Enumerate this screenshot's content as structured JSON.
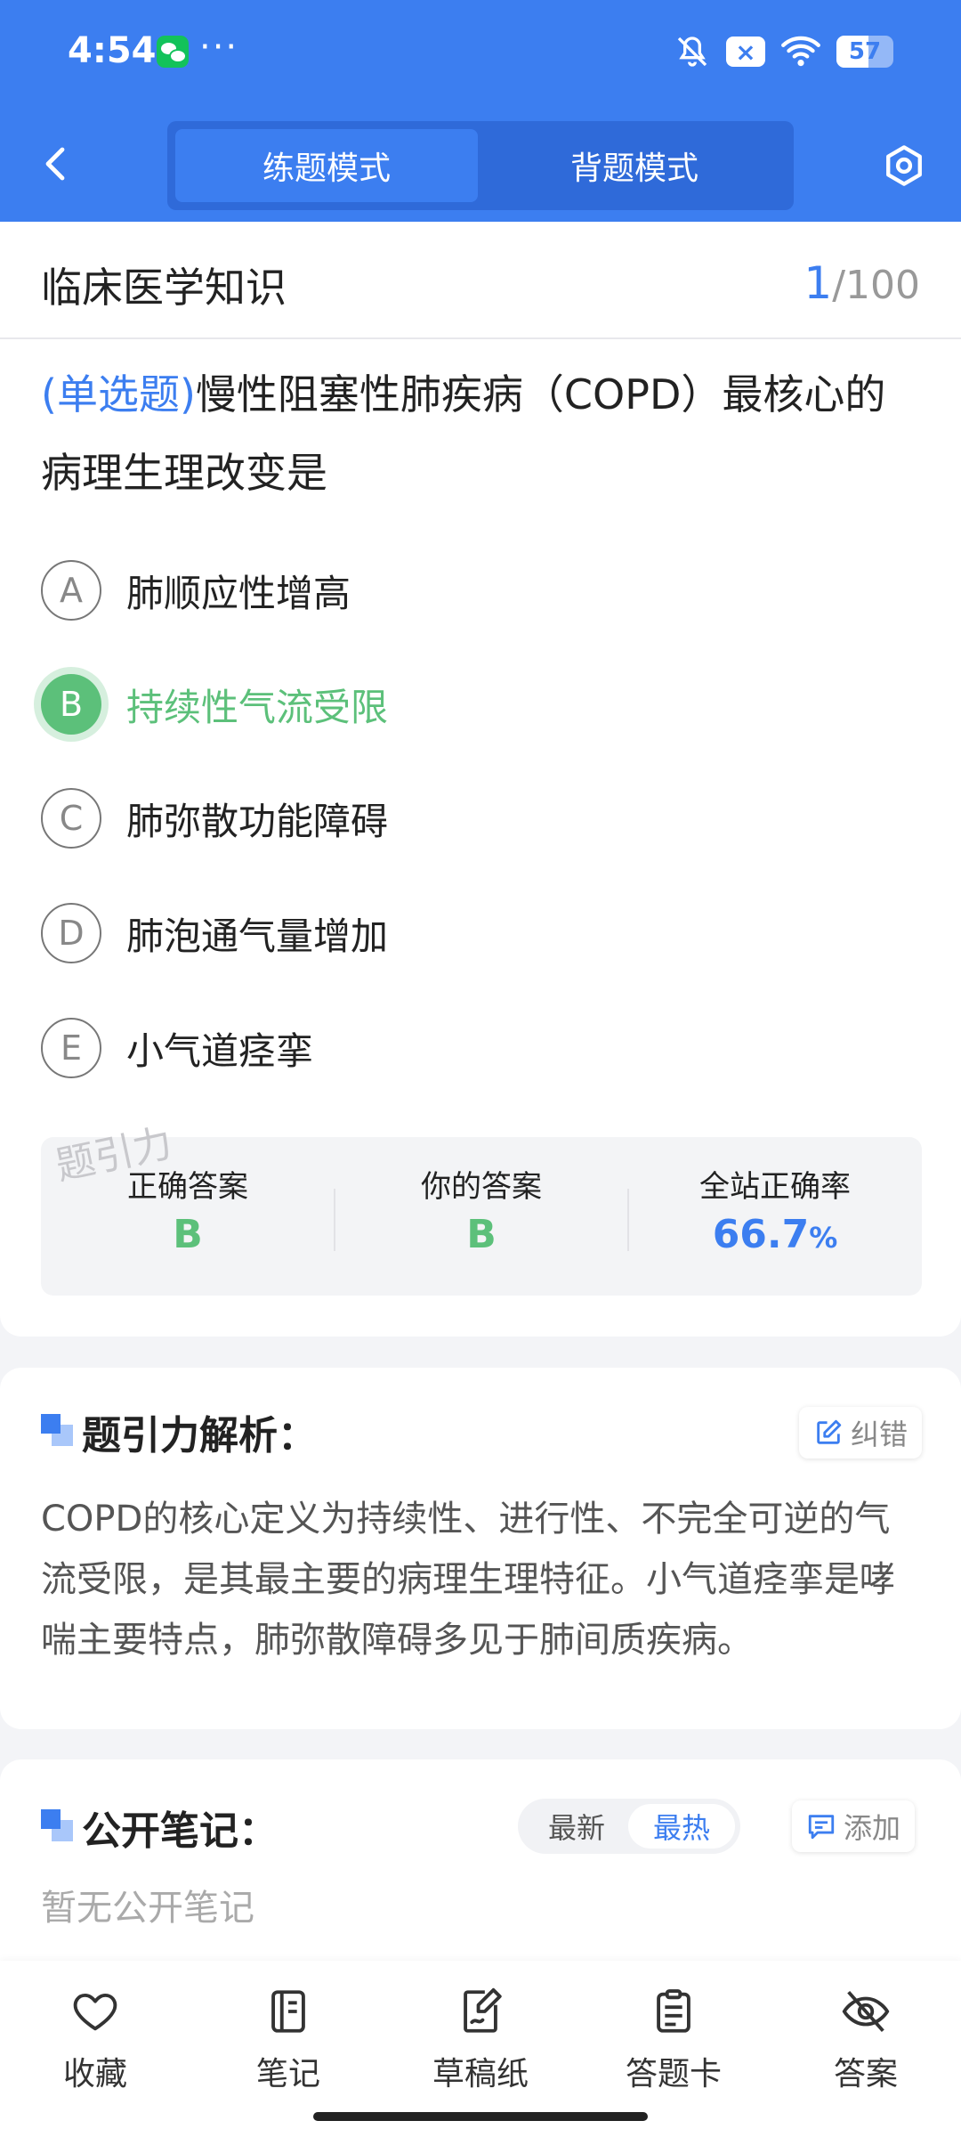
{
  "status_bar": {
    "time": "4:54",
    "more": "···",
    "x_badge": "×",
    "battery": "57"
  },
  "header": {
    "tabs": [
      {
        "label": "练题模式",
        "active": true
      },
      {
        "label": "背题模式",
        "active": false
      }
    ]
  },
  "subject": {
    "title": "临床医学知识",
    "current": "1",
    "total": "/100"
  },
  "question": {
    "type": "(单选题)",
    "text": "慢性阻塞性肺疾病（COPD）最核心的病理生理改变是",
    "options": [
      {
        "letter": "A",
        "text": "肺顺应性增高"
      },
      {
        "letter": "B",
        "text": "持续性气流受限",
        "correct": true
      },
      {
        "letter": "C",
        "text": "肺弥散功能障碍"
      },
      {
        "letter": "D",
        "text": "肺泡通气量增加"
      },
      {
        "letter": "E",
        "text": "小气道痉挛"
      }
    ]
  },
  "result": {
    "watermark": "题引力",
    "correct_label": "正确答案",
    "correct_value": "B",
    "yours_label": "你的答案",
    "yours_value": "B",
    "rate_label": "全站正确率",
    "rate_value": "66.7",
    "rate_unit": "%"
  },
  "analysis": {
    "title": "题引力解析：",
    "report_label": "纠错",
    "text": "COPD的核心定义为持续性、进行性、不完全可逆的气流受限，是其最主要的病理生理特征。小气道痉挛是哮喘主要特点，肺弥散障碍多见于肺间质疾病。"
  },
  "notes": {
    "title": "公开笔记：",
    "sort_newest": "最新",
    "sort_hottest": "最热",
    "add_label": "添加",
    "empty": "暂无公开笔记"
  },
  "bottom_nav": [
    {
      "label": "收藏",
      "icon": "heart-icon"
    },
    {
      "label": "笔记",
      "icon": "notebook-icon"
    },
    {
      "label": "草稿纸",
      "icon": "draft-icon"
    },
    {
      "label": "答题卡",
      "icon": "answer-sheet-icon"
    },
    {
      "label": "答案",
      "icon": "eye-off-icon"
    }
  ],
  "colors": {
    "primary": "#3c7ef0",
    "correct": "#5cc07a"
  }
}
